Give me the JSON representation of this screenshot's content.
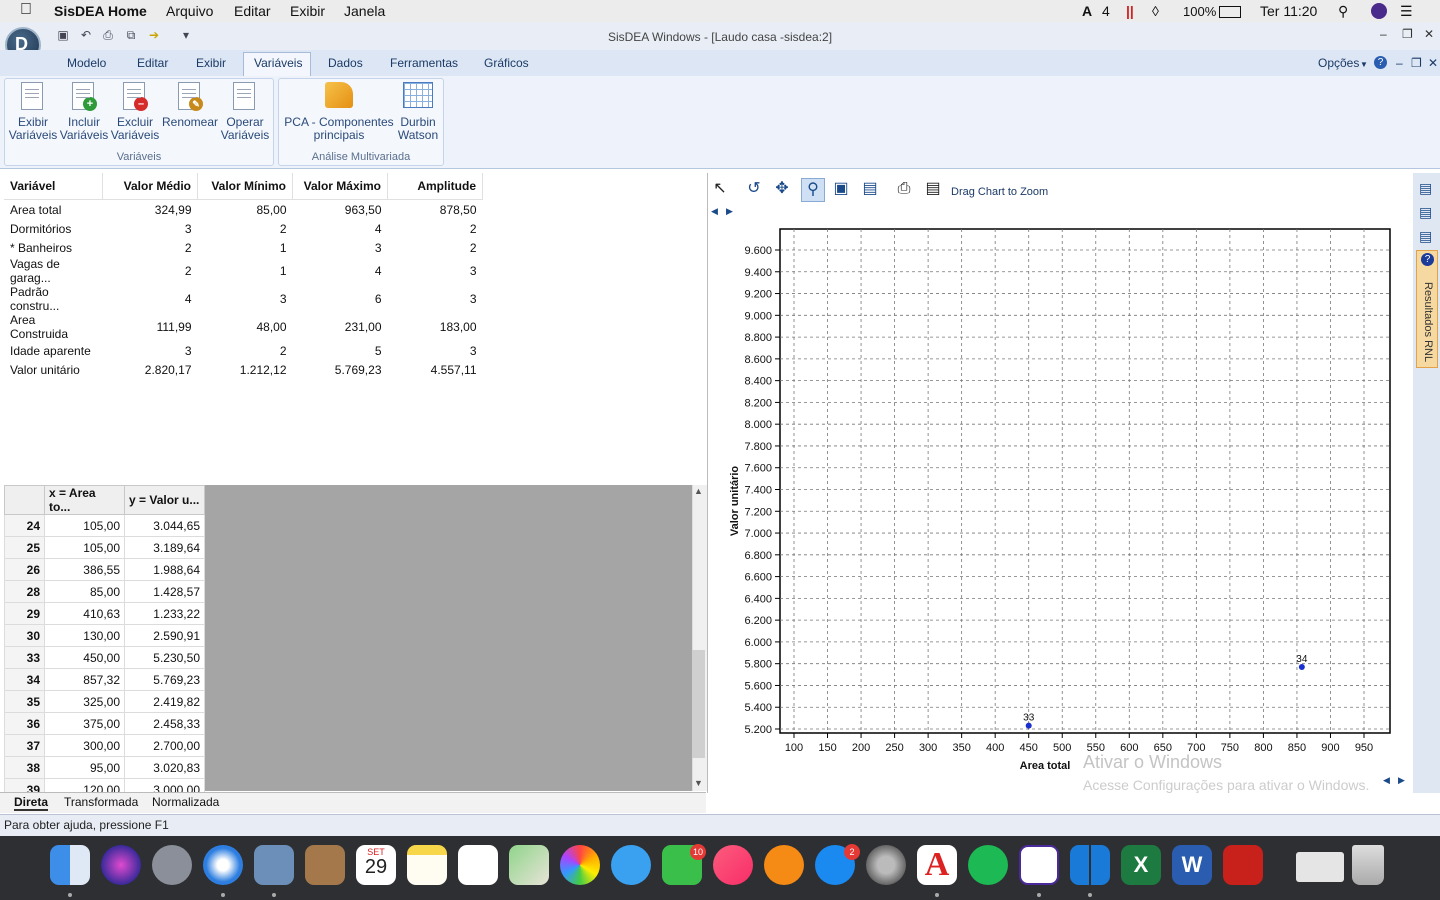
{
  "macbar": {
    "app": "SisDEA Home",
    "menus": [
      "Arquivo",
      "Editar",
      "Exibir",
      "Janela"
    ],
    "status_num": "4",
    "battery": "100%",
    "clock": "Ter 11:20"
  },
  "window": {
    "title": "SisDEA Windows - [Laudo casa -sisdea:2]"
  },
  "ribbon": {
    "tabs": [
      "Modelo",
      "Editar",
      "Exibir",
      "Variáveis",
      "Dados",
      "Ferramentas",
      "Gráficos"
    ],
    "options": "Opções",
    "groups": [
      {
        "label": "Variáveis",
        "buttons": [
          [
            "Exibir",
            "Variáveis"
          ],
          [
            "Incluir",
            "Variáveis"
          ],
          [
            "Excluir",
            "Variáveis"
          ],
          [
            "Renomear",
            ""
          ],
          [
            "Operar",
            "Variáveis"
          ]
        ]
      },
      {
        "label": "Análise Multivariada",
        "buttons": [
          [
            "PCA - Componentes",
            "principais"
          ],
          [
            "Durbin",
            "Watson"
          ]
        ]
      }
    ]
  },
  "stats": {
    "headers": [
      "Variável",
      "Valor Médio",
      "Valor Mínimo",
      "Valor Máximo",
      "Amplitude"
    ],
    "rows": [
      [
        "Area total",
        "324,99",
        "85,00",
        "963,50",
        "878,50"
      ],
      [
        "Dormitórios",
        "3",
        "2",
        "4",
        "2"
      ],
      [
        "* Banheiros",
        "2",
        "1",
        "3",
        "2"
      ],
      [
        "Vagas de garag...",
        "2",
        "1",
        "4",
        "3"
      ],
      [
        "Padrão constru...",
        "4",
        "3",
        "6",
        "3"
      ],
      [
        "Area Construida",
        "111,99",
        "48,00",
        "231,00",
        "183,00"
      ],
      [
        "Idade aparente",
        "3",
        "2",
        "5",
        "3"
      ],
      [
        "Valor unitário",
        "2.820,17",
        "1.212,12",
        "5.769,23",
        "4.557,11"
      ]
    ]
  },
  "grid": {
    "headers": [
      "x = Area to...",
      "y = Valor u..."
    ],
    "rows": [
      [
        "24",
        "105,00",
        "3.044,65"
      ],
      [
        "25",
        "105,00",
        "3.189,64"
      ],
      [
        "26",
        "386,55",
        "1.988,64"
      ],
      [
        "28",
        "85,00",
        "1.428,57"
      ],
      [
        "29",
        "410,63",
        "1.233,22"
      ],
      [
        "30",
        "130,00",
        "2.590,91"
      ],
      [
        "33",
        "450,00",
        "5.230,50"
      ],
      [
        "34",
        "857,32",
        "5.769,23"
      ],
      [
        "35",
        "325,00",
        "2.419,82"
      ],
      [
        "36",
        "375,00",
        "2.458,33"
      ],
      [
        "37",
        "300,00",
        "2.700,00"
      ],
      [
        "38",
        "95,00",
        "3.020,83"
      ],
      [
        "39",
        "120,00",
        "3.000,00"
      ]
    ]
  },
  "sheet_tabs": [
    "Direta",
    "Transformada",
    "Normalizada"
  ],
  "chart_toolbar": {
    "zoom_label": "Drag Chart to Zoom"
  },
  "chart_data": {
    "type": "scatter",
    "xlabel": "Area total",
    "ylabel": "Valor unitário",
    "xlim": [
      100,
      950
    ],
    "ylim": [
      5200,
      9600
    ],
    "xticks": [
      100,
      150,
      200,
      250,
      300,
      350,
      400,
      450,
      500,
      550,
      600,
      650,
      700,
      750,
      800,
      850,
      900,
      950
    ],
    "xtick_labels": [
      "100",
      "150",
      "200",
      "250",
      "300",
      "350",
      "400",
      "450",
      "500",
      "550",
      "600",
      "650",
      "700",
      "750",
      "800",
      "850",
      "900",
      "950"
    ],
    "yticks": [
      5200,
      5400,
      5600,
      5800,
      6000,
      6200,
      6400,
      6600,
      6800,
      7000,
      7200,
      7400,
      7600,
      7800,
      8000,
      8200,
      8400,
      8600,
      8800,
      9000,
      9200,
      9400,
      9600
    ],
    "ytick_labels": [
      "5.200",
      "5.400",
      "5.600",
      "5.800",
      "6.000",
      "6.200",
      "6.400",
      "6.600",
      "6.800",
      "7.000",
      "7.200",
      "7.400",
      "7.600",
      "7.800",
      "8.000",
      "8.200",
      "8.400",
      "8.600",
      "8.800",
      "9.000",
      "9.200",
      "9.400",
      "9.600"
    ],
    "grid": true,
    "points": [
      {
        "label": "33",
        "x": 450,
        "y": 5230.5
      },
      {
        "label": "34",
        "x": 857.32,
        "y": 5769.23
      }
    ],
    "colors": {
      "points": "#1a2fd0"
    }
  },
  "side_tab": "Resultados RNL",
  "watermark": {
    "line1": "Ativar o Windows",
    "line2": "Acesse Configurações para ativar o Windows."
  },
  "status": "Para obter ajuda, pressione F1",
  "dock": {
    "calendar_month": "SET",
    "calendar_day": "29",
    "facetime_badge": "10",
    "appstore_badge": "2"
  }
}
